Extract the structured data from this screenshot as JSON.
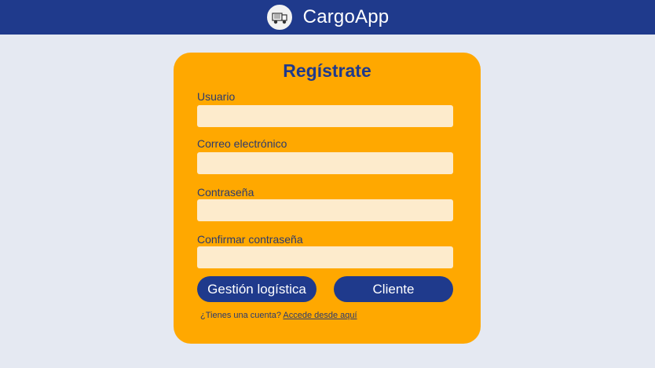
{
  "header": {
    "app_name": "CargoApp",
    "logo_icon": "truck-icon",
    "background_color": "#1F3A8C"
  },
  "form": {
    "title": "Regístrate",
    "fields": [
      {
        "label": "Usuario",
        "value": "",
        "placeholder": ""
      },
      {
        "label": "Correo electrónico",
        "value": "",
        "placeholder": ""
      },
      {
        "label": "Contraseña",
        "value": "",
        "placeholder": ""
      },
      {
        "label": "Confirmar contraseña",
        "value": "",
        "placeholder": ""
      }
    ],
    "buttons": {
      "logistica_label": "Gestión logística",
      "cliente_label": "Cliente"
    },
    "footer": {
      "prompt": "¿Tienes una  cuenta?",
      "link_label": "Accede desde aquí"
    },
    "card_color": "#FFA800",
    "input_color": "#FDEBCC",
    "button_color": "#1F3A8C"
  }
}
